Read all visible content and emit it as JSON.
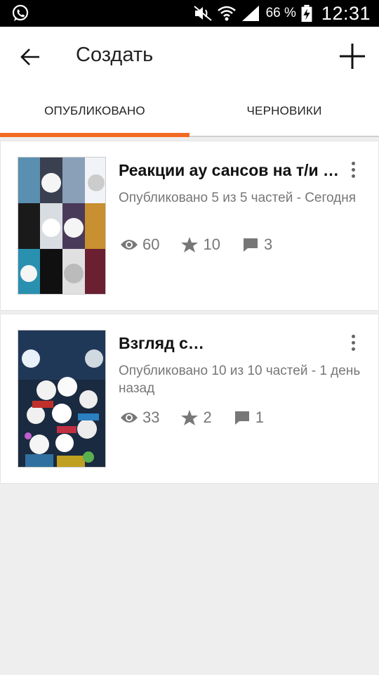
{
  "status_bar": {
    "battery_percent": "66 %",
    "time": "12:31",
    "icons": [
      "whatsapp-icon",
      "mute-icon",
      "wifi-icon",
      "signal-icon",
      "battery-charging-icon"
    ]
  },
  "app_bar": {
    "title": "Создать",
    "back_icon": "back-arrow-icon",
    "add_icon": "plus-icon"
  },
  "tabs": [
    {
      "label": "ОПУБЛИКОВАНО",
      "active": true
    },
    {
      "label": "ЧЕРНОВИКИ",
      "active": false
    }
  ],
  "stories": [
    {
      "title": "Реакции ау сансов на т/и …",
      "meta": "Опубликовано 5 из 5 частей - Сегодня",
      "views": "60",
      "votes": "10",
      "comments": "3"
    },
    {
      "title": "Взгляд с…",
      "meta": "Опубликовано 10 из 10 частей - 1 день назад",
      "views": "33",
      "votes": "2",
      "comments": "1"
    }
  ],
  "colors": {
    "accent": "#f36b22",
    "background": "#efeeee",
    "card": "#ffffff",
    "meta_text": "#777777"
  }
}
